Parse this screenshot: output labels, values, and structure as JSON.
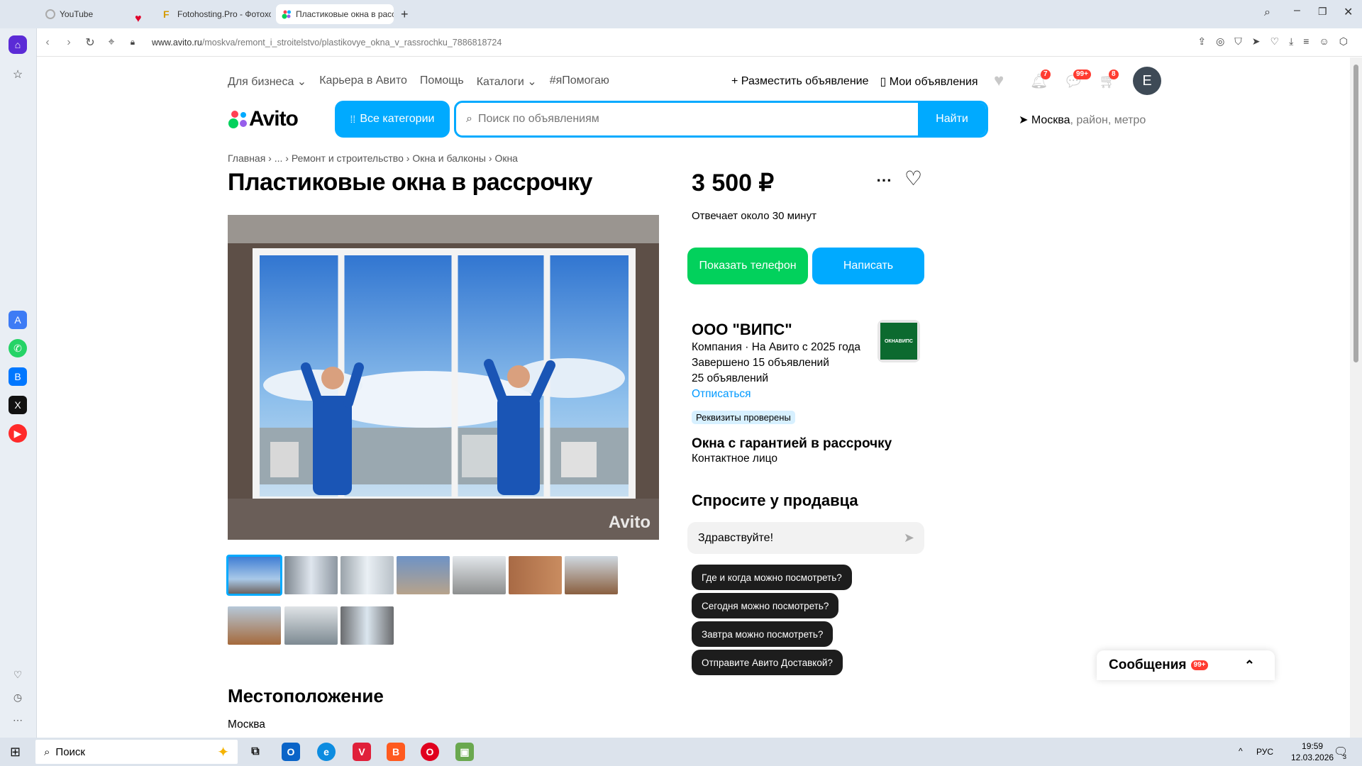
{
  "browser": {
    "tabs": [
      {
        "label": "YouTube"
      },
      {
        "label": "Fotohosting.Pro - Фотохо"
      },
      {
        "label": "Пластиковые окна в расс"
      }
    ],
    "url_domain": "www.avito.ru",
    "url_path": "/moskva/remont_i_stroitelstvo/plastikovye_okna_v_rassrochku_7886818724"
  },
  "header": {
    "nav": [
      "Для бизнеса",
      "Карьера в Авито",
      "Помощь",
      "Каталоги",
      "#яПомогаю"
    ],
    "post_ad": "Разместить объявление",
    "my_ads": "Мои объявления",
    "notifications_badge": "7",
    "messages_badge": "99+",
    "cart_badge": "8",
    "avatar_letter": "E",
    "logo": "Avito",
    "all_categories": "Все категории",
    "search_placeholder": "Поиск по объявлениям",
    "search_button": "Найти",
    "city": "Москва",
    "city_hint": ", район, метро"
  },
  "breadcrumbs": [
    "Главная",
    "...",
    "Ремонт и строительство",
    "Окна и балконы",
    "Окна"
  ],
  "listing": {
    "title": "Пластиковые окна в рассрочку",
    "price": "3 500 ₽",
    "response_time": "Отвечает около 30 минут",
    "show_phone": "Показать телефон",
    "write": "Написать",
    "watermark": "Avito",
    "location_heading": "Местоположение",
    "location": "Москва"
  },
  "seller": {
    "name": "ООО \"ВИПС\"",
    "line1": "Компания · На Авито с 2025 года",
    "line2": "Завершено 15 объявлений",
    "line3": "25 объявлений",
    "unsubscribe": "Отписаться",
    "verified_tag": "Реквизиты проверены",
    "logo_text": "ОКНАВИПС",
    "contact_title": "Окна с гарантией в рассрочку",
    "contact_role": "Контактное лицо"
  },
  "ask": {
    "heading": "Спросите у продавца",
    "input_value": "Здравствуйте!",
    "chips": [
      "Где и когда можно посмотреть?",
      "Сегодня можно посмотреть?",
      "Завтра можно посмотреть?",
      "Отправите Авито Доставкой?"
    ]
  },
  "messages_widget": {
    "label": "Сообщения",
    "badge": "99+"
  },
  "taskbar": {
    "search": "Поиск",
    "lang": "РУС",
    "time": "19:59",
    "date": "12.03.2026",
    "notif": "3"
  },
  "colors": {
    "accent": "#00aaff",
    "green": "#02d15c",
    "badge": "#ff3b30"
  }
}
